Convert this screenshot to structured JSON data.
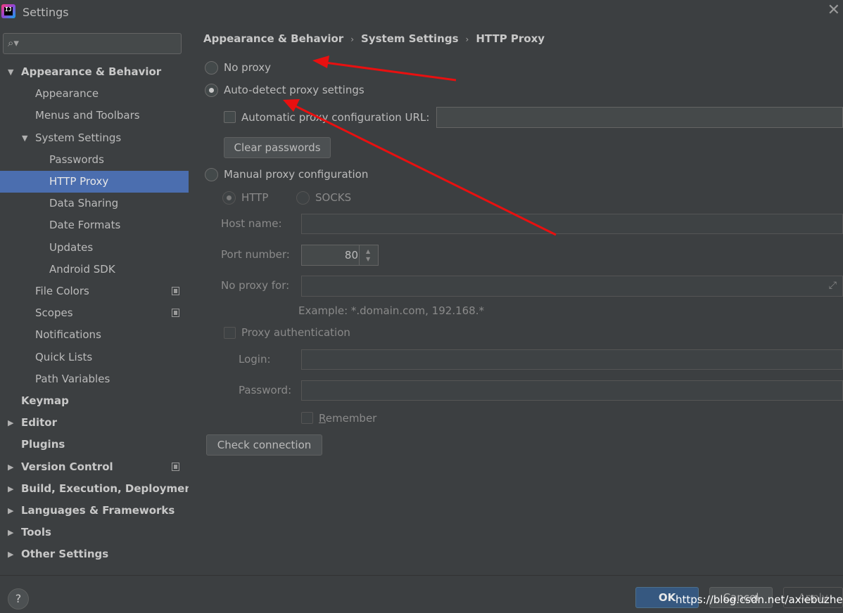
{
  "window": {
    "title": "Settings",
    "close_glyph": "✕"
  },
  "search": {
    "placeholder": "",
    "value": "",
    "icon": "search-icon"
  },
  "sidebar": {
    "items": [
      {
        "label": "Appearance & Behavior",
        "arrow": "▼",
        "bold": true
      },
      {
        "label": "Appearance"
      },
      {
        "label": "Menus and Toolbars"
      },
      {
        "label": "System Settings",
        "arrow": "▼"
      },
      {
        "label": "Passwords"
      },
      {
        "label": "HTTP Proxy",
        "selected": true
      },
      {
        "label": "Data Sharing"
      },
      {
        "label": "Date Formats"
      },
      {
        "label": "Updates"
      },
      {
        "label": "Android SDK"
      },
      {
        "label": "File Colors",
        "project_icon": true
      },
      {
        "label": "Scopes",
        "project_icon": true
      },
      {
        "label": "Notifications"
      },
      {
        "label": "Quick Lists"
      },
      {
        "label": "Path Variables"
      },
      {
        "label": "Keymap",
        "bold": true
      },
      {
        "label": "Editor",
        "arrow": "▶",
        "bold": true
      },
      {
        "label": "Plugins",
        "bold": true
      },
      {
        "label": "Version Control",
        "arrow": "▶",
        "bold": true,
        "project_icon": true
      },
      {
        "label": "Build, Execution, Deployment",
        "arrow": "▶",
        "bold": true
      },
      {
        "label": "Languages & Frameworks",
        "arrow": "▶",
        "bold": true
      },
      {
        "label": "Tools",
        "arrow": "▶",
        "bold": true
      },
      {
        "label": "Other Settings",
        "arrow": "▶",
        "bold": true
      }
    ]
  },
  "breadcrumb": {
    "part1": "Appearance & Behavior",
    "part2": "System Settings",
    "part3": "HTTP Proxy",
    "sep": "›"
  },
  "proxy": {
    "no_proxy_label": "No proxy",
    "auto_detect_label": "Auto-detect proxy settings",
    "auto_config_url_label": "Automatic proxy configuration URL:",
    "auto_config_url_value": "",
    "clear_passwords_label": "Clear passwords",
    "manual_label": "Manual proxy configuration",
    "http_label": "HTTP",
    "socks_label": "SOCKS",
    "host_label": "Host name:",
    "host_value": "",
    "port_label": "Port number:",
    "port_value": "80",
    "no_proxy_for_label": "No proxy for:",
    "no_proxy_for_value": "",
    "example_text": "Example: *.domain.com, 192.168.*",
    "proxy_auth_label": "Proxy authentication",
    "proxy_auth_underlined": "a",
    "login_label": "Login:",
    "login_value": "",
    "password_label": "Password:",
    "password_value": "",
    "remember_label": "Remember",
    "check_connection_label": "Check connection",
    "selected_mode": "auto-detect"
  },
  "footer": {
    "help_label": "?",
    "ok_label": "OK",
    "cancel_label": "Cancel",
    "apply_label": "Apply",
    "watermark": "https://blog.csdn.net/axiebuzhen"
  },
  "colors": {
    "background": "#3c3f41",
    "selection": "#4b6eaf",
    "ok_button": "#365880",
    "annotation_arrows": "#e81010"
  }
}
